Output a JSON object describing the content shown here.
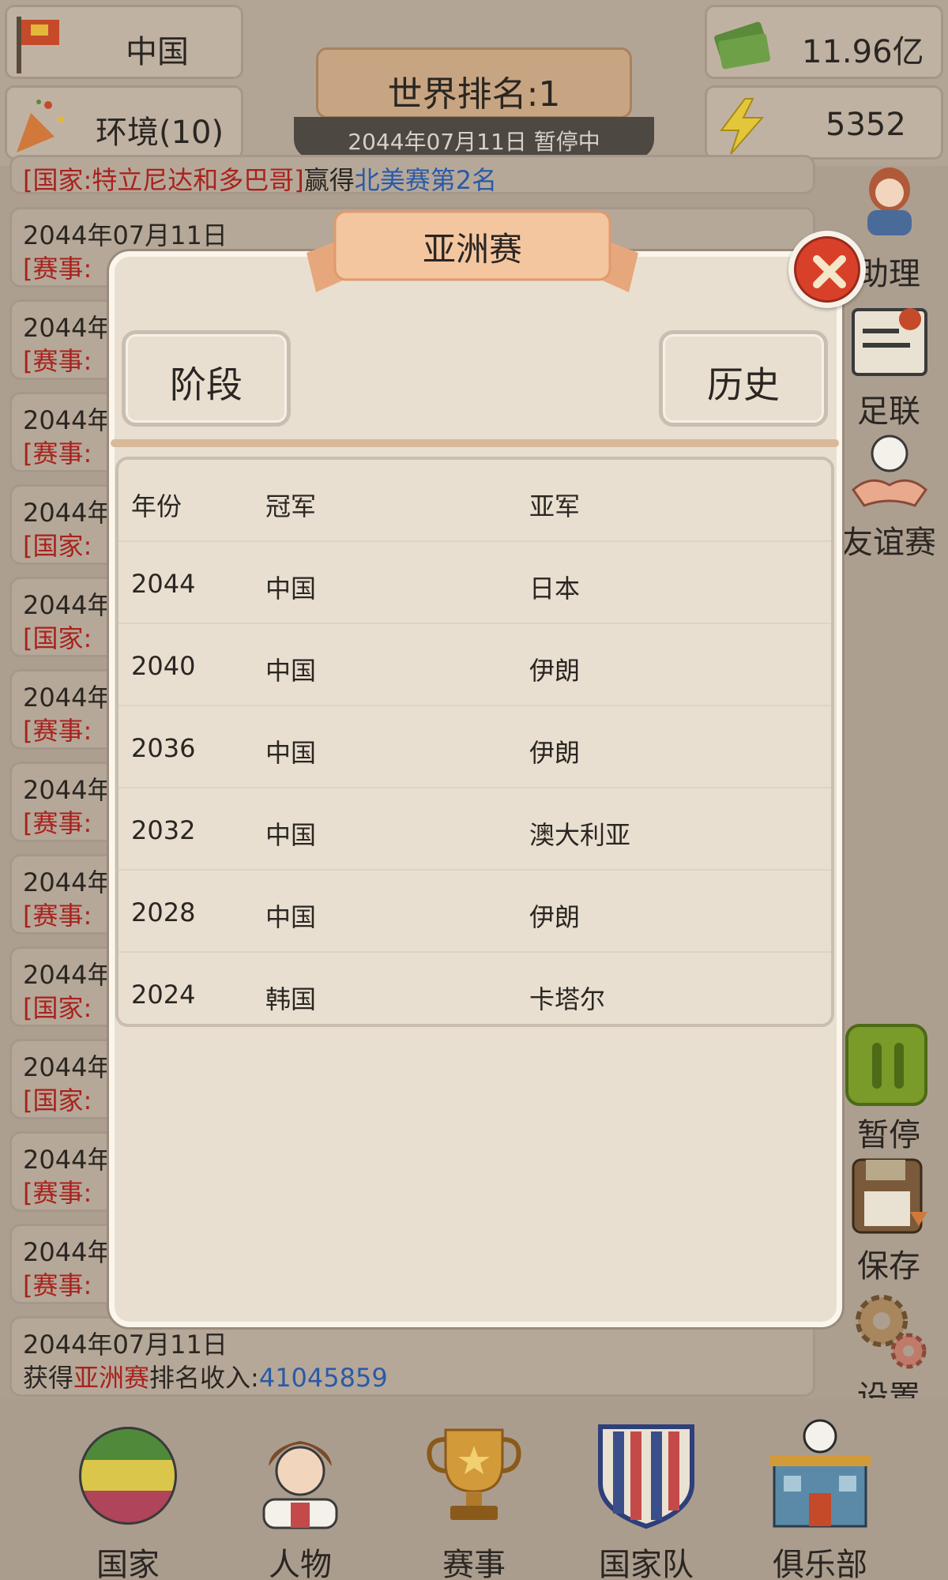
{
  "header": {
    "country": "中国",
    "environment": "环境(10)",
    "world_rank": "世界排名:1",
    "date_status": "2044年07月11日  暂停中",
    "money": "11.96亿",
    "energy": "5352"
  },
  "feed": [
    {
      "date": "",
      "parts": [
        {
          "t": "[国家:特立尼达和多巴哥]",
          "c": "r"
        },
        {
          "t": "赢得",
          "c": "p"
        },
        {
          "t": "北美赛",
          "c": "b"
        },
        {
          "t": "第2名",
          "c": "b"
        }
      ]
    },
    {
      "date": "2044年07月11日",
      "tag": "[赛事:"
    },
    {
      "date": "2044年",
      "tag": "[赛事:"
    },
    {
      "date": "2044年",
      "tag": "[赛事:"
    },
    {
      "date": "2044年",
      "tag": "[国家:"
    },
    {
      "date": "2044年",
      "tag": "[国家:"
    },
    {
      "date": "2044年",
      "tag": "[赛事:"
    },
    {
      "date": "2044年",
      "tag": "[赛事:"
    },
    {
      "date": "2044年",
      "tag": "[赛事:"
    },
    {
      "date": "2044年",
      "tag": "[国家:"
    },
    {
      "date": "2044年",
      "tag": "[国家:"
    },
    {
      "date": "2044年",
      "tag": "[赛事:"
    },
    {
      "date": "2044年",
      "tag": "[赛事:"
    },
    {
      "date": "2044年07月11日",
      "parts": [
        {
          "t": "获得",
          "c": "p"
        },
        {
          "t": "亚洲赛",
          "c": "r"
        },
        {
          "t": "排名收入:",
          "c": "p"
        },
        {
          "t": "41045859",
          "c": "b"
        }
      ]
    }
  ],
  "side_menu": [
    "助理",
    "足联",
    "友谊赛",
    "暂停",
    "保存",
    "设置"
  ],
  "bottom_nav": [
    "国家",
    "人物",
    "赛事",
    "国家队",
    "俱乐部"
  ],
  "dialog": {
    "title": "亚洲赛",
    "stage_button": "阶段",
    "history_button": "历史",
    "columns": [
      "年份",
      "冠军",
      "亚军"
    ],
    "rows": [
      [
        "2044",
        "中国",
        "日本"
      ],
      [
        "2040",
        "中国",
        "伊朗"
      ],
      [
        "2036",
        "中国",
        "伊朗"
      ],
      [
        "2032",
        "中国",
        "澳大利亚"
      ],
      [
        "2028",
        "中国",
        "伊朗"
      ],
      [
        "2024",
        "韩国",
        "卡塔尔"
      ]
    ]
  },
  "colors": {
    "accent_red": "#a8221e",
    "accent_blue": "#2a5aa8",
    "pause_green": "#7a9a2a"
  }
}
